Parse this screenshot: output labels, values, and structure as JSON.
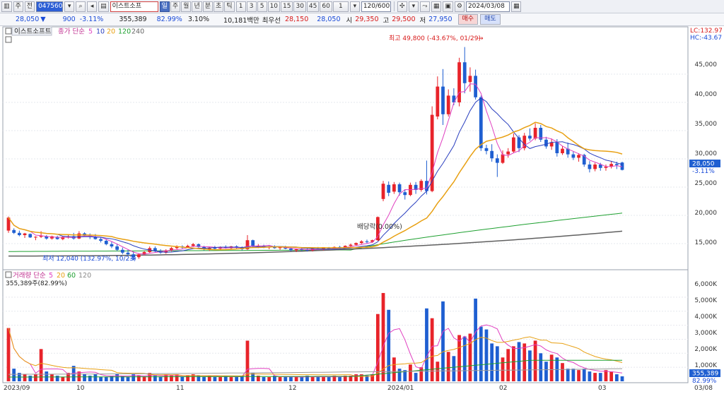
{
  "toolbar": {
    "buttons_left": [
      "▥",
      "주"
    ],
    "market_select": "전",
    "code": "047560",
    "stock_name": "이스트소프",
    "period_buttons": [
      "일",
      "주",
      "월",
      "년",
      "분",
      "초",
      "틱"
    ],
    "active_period": "일",
    "interval_buttons": [
      "1",
      "3",
      "5",
      "10",
      "15",
      "30",
      "45",
      "60",
      "1"
    ],
    "view_count": "120/600",
    "date": "2024/03/08"
  },
  "quote": {
    "price": "28,050",
    "change_arrow": "▼",
    "change": "900",
    "change_pct": "-3.11%",
    "volume": "355,389",
    "volume_ratio": "82.99%",
    "turnover": "3.10%",
    "amount": "10,181백만",
    "best_bid_label": "최우선",
    "best_bid": "28,150",
    "best_ask": "28,050",
    "open_label": "시",
    "open": "29,350",
    "high_label": "고",
    "high": "29,500",
    "low_label": "저",
    "low": "27,950",
    "buy_label": "매수",
    "sell_label": "매도"
  },
  "price_panel": {
    "stock_label": "이스트소프트",
    "ma_label": "종가 단순",
    "ma_periods": [
      "5",
      "10",
      "20",
      "120",
      "240"
    ],
    "lc_label": "LC:132.97",
    "hc_label": "HC:-43.67",
    "y_ticks": [
      "45,000",
      "40,000",
      "35,000",
      "30,000",
      "25,000",
      "20,000",
      "15,000"
    ],
    "current_price_tag": "28,050",
    "current_change_tag": "-3.11%",
    "high_annotation": "최고 49,800 (-43.67%, 01/29)",
    "low_annotation": "최저 12,040 (132.97%, 10/23)",
    "dividend_annotation": "배당락(0.00%)"
  },
  "volume_panel": {
    "label": "거래량 단순",
    "ma_periods": [
      "5",
      "20",
      "60",
      "120"
    ],
    "sub_label": "355,389주(82.99%)",
    "y_ticks": [
      "6,000K",
      "5,000K",
      "4,000K",
      "3,000K",
      "2,000K",
      "1,000K"
    ],
    "current_tag": "355,389",
    "current_pct_tag": "82.99%"
  },
  "x_axis": {
    "labels": [
      "2023/09",
      "10",
      "11",
      "12",
      "2024/01",
      "02",
      "03",
      "03/08"
    ]
  },
  "colors": {
    "up": "#e8232a",
    "down": "#1f5fd1",
    "ma5": "#e040c0",
    "ma10": "#2a3fbf",
    "ma20": "#e8a012",
    "ma120": "#1ea030",
    "ma240": "#606060"
  },
  "chart_data": {
    "type": "candlestick",
    "y_range": [
      11000,
      50500
    ],
    "volume_range_k": [
      0,
      6600
    ],
    "candles": [
      {
        "o": 17300,
        "h": 19800,
        "l": 16900,
        "c": 19600,
        "v": 3800
      },
      {
        "o": 17400,
        "h": 17700,
        "l": 16700,
        "c": 16900,
        "v": 900
      },
      {
        "o": 16900,
        "h": 17300,
        "l": 16300,
        "c": 16500,
        "v": 600
      },
      {
        "o": 16500,
        "h": 16900,
        "l": 16000,
        "c": 16800,
        "v": 500
      },
      {
        "o": 16700,
        "h": 16800,
        "l": 16000,
        "c": 16100,
        "v": 400
      },
      {
        "o": 16100,
        "h": 16300,
        "l": 15600,
        "c": 16200,
        "v": 500
      },
      {
        "o": 16200,
        "h": 17200,
        "l": 16000,
        "c": 16400,
        "v": 2300
      },
      {
        "o": 16300,
        "h": 16500,
        "l": 15700,
        "c": 15900,
        "v": 700
      },
      {
        "o": 15900,
        "h": 16400,
        "l": 15700,
        "c": 16300,
        "v": 500
      },
      {
        "o": 16200,
        "h": 16400,
        "l": 15700,
        "c": 15800,
        "v": 400
      },
      {
        "o": 15800,
        "h": 16300,
        "l": 15600,
        "c": 16200,
        "v": 300
      },
      {
        "o": 16200,
        "h": 16600,
        "l": 15900,
        "c": 16300,
        "v": 600
      },
      {
        "o": 16300,
        "h": 16900,
        "l": 15700,
        "c": 15900,
        "v": 1100
      },
      {
        "o": 15900,
        "h": 17200,
        "l": 15800,
        "c": 16800,
        "v": 700
      },
      {
        "o": 16800,
        "h": 17000,
        "l": 16200,
        "c": 16400,
        "v": 500
      },
      {
        "o": 16400,
        "h": 16800,
        "l": 15800,
        "c": 16200,
        "v": 400
      },
      {
        "o": 16200,
        "h": 16700,
        "l": 15700,
        "c": 15800,
        "v": 500
      },
      {
        "o": 15800,
        "h": 16100,
        "l": 15200,
        "c": 15500,
        "v": 300
      },
      {
        "o": 15500,
        "h": 15800,
        "l": 14700,
        "c": 14900,
        "v": 300
      },
      {
        "o": 14900,
        "h": 15300,
        "l": 14200,
        "c": 14500,
        "v": 400
      },
      {
        "o": 14500,
        "h": 15000,
        "l": 13700,
        "c": 13900,
        "v": 500
      },
      {
        "o": 13900,
        "h": 14300,
        "l": 13100,
        "c": 13400,
        "v": 400
      },
      {
        "o": 13400,
        "h": 13900,
        "l": 12900,
        "c": 13100,
        "v": 300
      },
      {
        "o": 13100,
        "h": 13600,
        "l": 12040,
        "c": 12600,
        "v": 500
      },
      {
        "o": 12600,
        "h": 13300,
        "l": 12300,
        "c": 13100,
        "v": 400
      },
      {
        "o": 13100,
        "h": 13700,
        "l": 12900,
        "c": 13500,
        "v": 300
      },
      {
        "o": 13500,
        "h": 14500,
        "l": 13300,
        "c": 14200,
        "v": 600
      },
      {
        "o": 14200,
        "h": 14500,
        "l": 13500,
        "c": 13700,
        "v": 400
      },
      {
        "o": 13700,
        "h": 14000,
        "l": 13200,
        "c": 13400,
        "v": 300
      },
      {
        "o": 13400,
        "h": 14000,
        "l": 13200,
        "c": 13800,
        "v": 500
      },
      {
        "o": 13800,
        "h": 14400,
        "l": 13600,
        "c": 14200,
        "v": 400
      },
      {
        "o": 14200,
        "h": 14700,
        "l": 14000,
        "c": 14500,
        "v": 500
      },
      {
        "o": 14500,
        "h": 14700,
        "l": 14100,
        "c": 14300,
        "v": 300
      },
      {
        "o": 14300,
        "h": 14800,
        "l": 14200,
        "c": 14600,
        "v": 400
      },
      {
        "o": 14600,
        "h": 15100,
        "l": 14400,
        "c": 14900,
        "v": 500
      },
      {
        "o": 14900,
        "h": 15000,
        "l": 14300,
        "c": 14400,
        "v": 400
      },
      {
        "o": 14400,
        "h": 14600,
        "l": 13800,
        "c": 14000,
        "v": 300
      },
      {
        "o": 14000,
        "h": 14400,
        "l": 13700,
        "c": 14300,
        "v": 400
      },
      {
        "o": 14300,
        "h": 14600,
        "l": 13900,
        "c": 14100,
        "v": 300
      },
      {
        "o": 14100,
        "h": 14500,
        "l": 13900,
        "c": 14400,
        "v": 300
      },
      {
        "o": 14400,
        "h": 14700,
        "l": 14100,
        "c": 14200,
        "v": 400
      },
      {
        "o": 14200,
        "h": 14600,
        "l": 14000,
        "c": 14500,
        "v": 300
      },
      {
        "o": 14500,
        "h": 14700,
        "l": 14100,
        "c": 14300,
        "v": 300
      },
      {
        "o": 14300,
        "h": 14500,
        "l": 13800,
        "c": 14000,
        "v": 400
      },
      {
        "o": 14000,
        "h": 16500,
        "l": 13900,
        "c": 15600,
        "v": 2900
      },
      {
        "o": 15600,
        "h": 15700,
        "l": 14300,
        "c": 14500,
        "v": 600
      },
      {
        "o": 14500,
        "h": 14900,
        "l": 14200,
        "c": 14600,
        "v": 400
      },
      {
        "o": 14600,
        "h": 14800,
        "l": 14200,
        "c": 14300,
        "v": 300
      },
      {
        "o": 14300,
        "h": 14600,
        "l": 14000,
        "c": 14500,
        "v": 300
      },
      {
        "o": 14500,
        "h": 14700,
        "l": 14100,
        "c": 14200,
        "v": 400
      },
      {
        "o": 14200,
        "h": 14500,
        "l": 13900,
        "c": 14400,
        "v": 300
      },
      {
        "o": 14400,
        "h": 14600,
        "l": 14000,
        "c": 14100,
        "v": 300
      },
      {
        "o": 14100,
        "h": 14300,
        "l": 13700,
        "c": 13800,
        "v": 300
      },
      {
        "o": 13800,
        "h": 14100,
        "l": 13500,
        "c": 14000,
        "v": 300
      },
      {
        "o": 14000,
        "h": 14200,
        "l": 13700,
        "c": 13900,
        "v": 300
      },
      {
        "o": 13900,
        "h": 14100,
        "l": 13600,
        "c": 13800,
        "v": 400
      },
      {
        "o": 13800,
        "h": 14200,
        "l": 13600,
        "c": 14100,
        "v": 300
      },
      {
        "o": 14100,
        "h": 14400,
        "l": 13900,
        "c": 14000,
        "v": 300
      },
      {
        "o": 14000,
        "h": 14300,
        "l": 13800,
        "c": 14200,
        "v": 300
      },
      {
        "o": 14200,
        "h": 14400,
        "l": 14000,
        "c": 14100,
        "v": 300
      },
      {
        "o": 14100,
        "h": 14500,
        "l": 14000,
        "c": 14400,
        "v": 400
      },
      {
        "o": 14400,
        "h": 14600,
        "l": 14100,
        "c": 14300,
        "v": 300
      },
      {
        "o": 14300,
        "h": 14700,
        "l": 14200,
        "c": 14600,
        "v": 400
      },
      {
        "o": 14600,
        "h": 15000,
        "l": 14400,
        "c": 14800,
        "v": 400
      },
      {
        "o": 14800,
        "h": 15200,
        "l": 14600,
        "c": 15100,
        "v": 500
      },
      {
        "o": 15100,
        "h": 15600,
        "l": 14900,
        "c": 15400,
        "v": 500
      },
      {
        "o": 15400,
        "h": 15700,
        "l": 15000,
        "c": 15300,
        "v": 400
      },
      {
        "o": 15300,
        "h": 15700,
        "l": 15100,
        "c": 15600,
        "v": 500
      },
      {
        "o": 15600,
        "h": 19800,
        "l": 15500,
        "c": 19700,
        "v": 4800
      },
      {
        "o": 22900,
        "h": 26100,
        "l": 22500,
        "c": 25600,
        "v": 6300
      },
      {
        "o": 25400,
        "h": 26000,
        "l": 23400,
        "c": 24000,
        "v": 5100
      },
      {
        "o": 24200,
        "h": 25900,
        "l": 23800,
        "c": 25500,
        "v": 1700
      },
      {
        "o": 25500,
        "h": 25800,
        "l": 23500,
        "c": 24100,
        "v": 900
      },
      {
        "o": 24100,
        "h": 24600,
        "l": 22800,
        "c": 23600,
        "v": 800
      },
      {
        "o": 23600,
        "h": 25800,
        "l": 23400,
        "c": 25400,
        "v": 1200
      },
      {
        "o": 25400,
        "h": 25900,
        "l": 23800,
        "c": 24500,
        "v": 600
      },
      {
        "o": 24500,
        "h": 26400,
        "l": 24200,
        "c": 26100,
        "v": 1000
      },
      {
        "o": 26100,
        "h": 29700,
        "l": 23700,
        "c": 24300,
        "v": 5200
      },
      {
        "o": 24300,
        "h": 39300,
        "l": 24100,
        "c": 37800,
        "v": 4500
      },
      {
        "o": 37500,
        "h": 44600,
        "l": 37000,
        "c": 42800,
        "v": 1400
      },
      {
        "o": 42800,
        "h": 45900,
        "l": 36000,
        "c": 37900,
        "v": 5700
      },
      {
        "o": 37900,
        "h": 42300,
        "l": 37500,
        "c": 41200,
        "v": 2100
      },
      {
        "o": 41200,
        "h": 42500,
        "l": 39500,
        "c": 40000,
        "v": 1800
      },
      {
        "o": 40000,
        "h": 47900,
        "l": 39300,
        "c": 47100,
        "v": 3300
      },
      {
        "o": 47100,
        "h": 49800,
        "l": 41600,
        "c": 43400,
        "v": 3200
      },
      {
        "o": 43600,
        "h": 46200,
        "l": 41900,
        "c": 44700,
        "v": 3400
      },
      {
        "o": 44700,
        "h": 45800,
        "l": 40500,
        "c": 40900,
        "v": 5900
      },
      {
        "o": 40900,
        "h": 41200,
        "l": 31400,
        "c": 31900,
        "v": 3900
      },
      {
        "o": 31900,
        "h": 32500,
        "l": 30800,
        "c": 31400,
        "v": 3700
      },
      {
        "o": 31400,
        "h": 32600,
        "l": 29500,
        "c": 30100,
        "v": 2700
      },
      {
        "o": 30100,
        "h": 30800,
        "l": 26800,
        "c": 29300,
        "v": 2500
      },
      {
        "o": 29300,
        "h": 31500,
        "l": 29100,
        "c": 30800,
        "v": 1700
      },
      {
        "o": 30800,
        "h": 31900,
        "l": 30200,
        "c": 31300,
        "v": 2300
      },
      {
        "o": 31300,
        "h": 34500,
        "l": 31000,
        "c": 33800,
        "v": 2500
      },
      {
        "o": 33800,
        "h": 34200,
        "l": 31200,
        "c": 31900,
        "v": 2800
      },
      {
        "o": 31900,
        "h": 34600,
        "l": 31500,
        "c": 34100,
        "v": 2700
      },
      {
        "o": 34100,
        "h": 35400,
        "l": 33200,
        "c": 33600,
        "v": 2200
      },
      {
        "o": 33600,
        "h": 36300,
        "l": 33300,
        "c": 35500,
        "v": 2900
      },
      {
        "o": 35500,
        "h": 36000,
        "l": 33000,
        "c": 33400,
        "v": 2000
      },
      {
        "o": 33400,
        "h": 33900,
        "l": 31800,
        "c": 32200,
        "v": 1400
      },
      {
        "o": 32200,
        "h": 33600,
        "l": 31600,
        "c": 32900,
        "v": 1900
      },
      {
        "o": 32900,
        "h": 33500,
        "l": 30400,
        "c": 31000,
        "v": 1700
      },
      {
        "o": 31000,
        "h": 32300,
        "l": 30700,
        "c": 31800,
        "v": 1300
      },
      {
        "o": 31800,
        "h": 32900,
        "l": 30200,
        "c": 30800,
        "v": 900
      },
      {
        "o": 30800,
        "h": 31300,
        "l": 29800,
        "c": 30200,
        "v": 900
      },
      {
        "o": 30200,
        "h": 31000,
        "l": 29500,
        "c": 30700,
        "v": 800
      },
      {
        "o": 30700,
        "h": 30900,
        "l": 28600,
        "c": 29000,
        "v": 900
      },
      {
        "o": 29000,
        "h": 29600,
        "l": 27600,
        "c": 28200,
        "v": 700
      },
      {
        "o": 28200,
        "h": 29300,
        "l": 27800,
        "c": 29000,
        "v": 600
      },
      {
        "o": 29000,
        "h": 29300,
        "l": 27900,
        "c": 28400,
        "v": 600
      },
      {
        "o": 28400,
        "h": 29000,
        "l": 27900,
        "c": 28600,
        "v": 800
      },
      {
        "o": 28600,
        "h": 29600,
        "l": 28300,
        "c": 29100,
        "v": 700
      },
      {
        "o": 29100,
        "h": 29500,
        "l": 28200,
        "c": 28900,
        "v": 500
      },
      {
        "o": 29350,
        "h": 29500,
        "l": 27950,
        "c": 28050,
        "v": 355
      }
    ],
    "ma120_start_end": [
      13600,
      20400
    ],
    "ma240_start_end": [
      12800,
      17200
    ],
    "vol_ma60_range_k": [
      300,
      1500
    ],
    "vol_ma120_range_k": [
      500,
      900
    ]
  }
}
